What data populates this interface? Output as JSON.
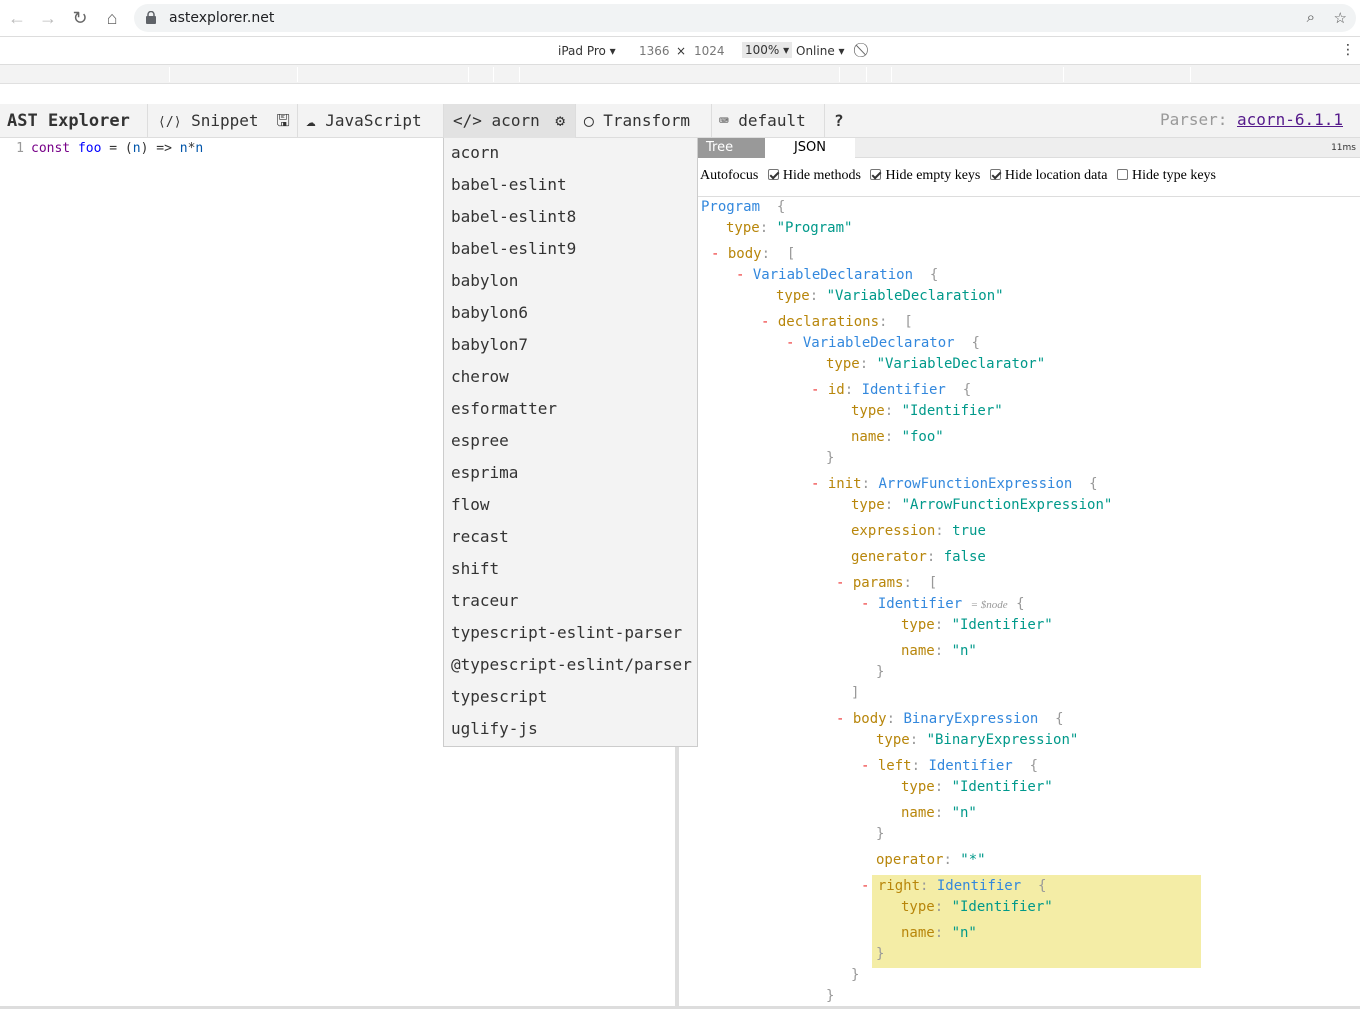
{
  "browser": {
    "url": "astexplorer.net",
    "back_icon": "←",
    "forward_icon": "→",
    "reload_icon": "↻",
    "home_icon": "⌂",
    "zoom_icon": "⌕",
    "star_icon": "☆"
  },
  "devtools": {
    "device": "iPad Pro ▾",
    "width": "1366",
    "times": "×",
    "height": "1024",
    "zoom": "100% ▾",
    "network": "Online ▾",
    "rotate_icon": "⃠",
    "more_icon": "⋮"
  },
  "toolbar": {
    "title": "AST Explorer",
    "snippet_icon": "⟨/⟩",
    "snippet": "Snippet",
    "save_icon": "🖫",
    "language_icon": "☁",
    "language": "JavaScript",
    "parser_icon": "</>",
    "parser": "acorn",
    "settings_icon": "⚙",
    "transform_icon": "◯",
    "transform": "Transform",
    "keymap_icon": "⌨",
    "keymap": "default",
    "help": "?",
    "parser_label": "Parser: ",
    "parser_version": "acorn-6.1.1"
  },
  "editor": {
    "line_number": "1",
    "code_kw": "const",
    "code_def": "foo",
    "code_eq": " = (",
    "code_n1": "n",
    "code_arrow": ") => ",
    "code_n2": "n",
    "code_mul": "*",
    "code_n3": "n"
  },
  "parser_menu": {
    "items": [
      "acorn",
      "babel-eslint",
      "babel-eslint8",
      "babel-eslint9",
      "babylon",
      "babylon6",
      "babylon7",
      "cherow",
      "esformatter",
      "espree",
      "esprima",
      "flow",
      "recast",
      "shift",
      "traceur",
      "typescript-eslint-parser",
      "@typescript-eslint/parser",
      "typescript",
      "uglify-js"
    ]
  },
  "output": {
    "tab_tree": "Tree",
    "tab_json": "JSON",
    "timing": "11ms",
    "options": {
      "autofocus": "Autofocus",
      "hide_methods": "Hide methods",
      "hide_empty": "Hide empty keys",
      "hide_location": "Hide location data",
      "hide_type": "Hide type keys"
    }
  },
  "tree": {
    "program": "Program",
    "type_key": "type",
    "program_type": "\"Program\"",
    "body_key": "body",
    "var_decl": "VariableDeclaration",
    "var_decl_type": "\"VariableDeclaration\"",
    "declarations_key": "declarations",
    "var_declarator": "VariableDeclarator",
    "var_declarator_type": "\"VariableDeclarator\"",
    "id_key": "id",
    "identifier": "Identifier",
    "identifier_type": "\"Identifier\"",
    "name_key": "name",
    "name_foo": "\"foo\"",
    "init_key": "init",
    "arrow": "ArrowFunctionExpression",
    "arrow_type": "\"ArrowFunctionExpression\"",
    "expression_key": "expression",
    "expression_val": "true",
    "generator_key": "generator",
    "generator_val": "false",
    "params_key": "params",
    "node_hint": "= $node",
    "name_n": "\"n\"",
    "binary": "BinaryExpression",
    "binary_type": "\"BinaryExpression\"",
    "left_key": "left",
    "operator_key": "operator",
    "operator_val": "\"*\"",
    "right_key": "right"
  }
}
